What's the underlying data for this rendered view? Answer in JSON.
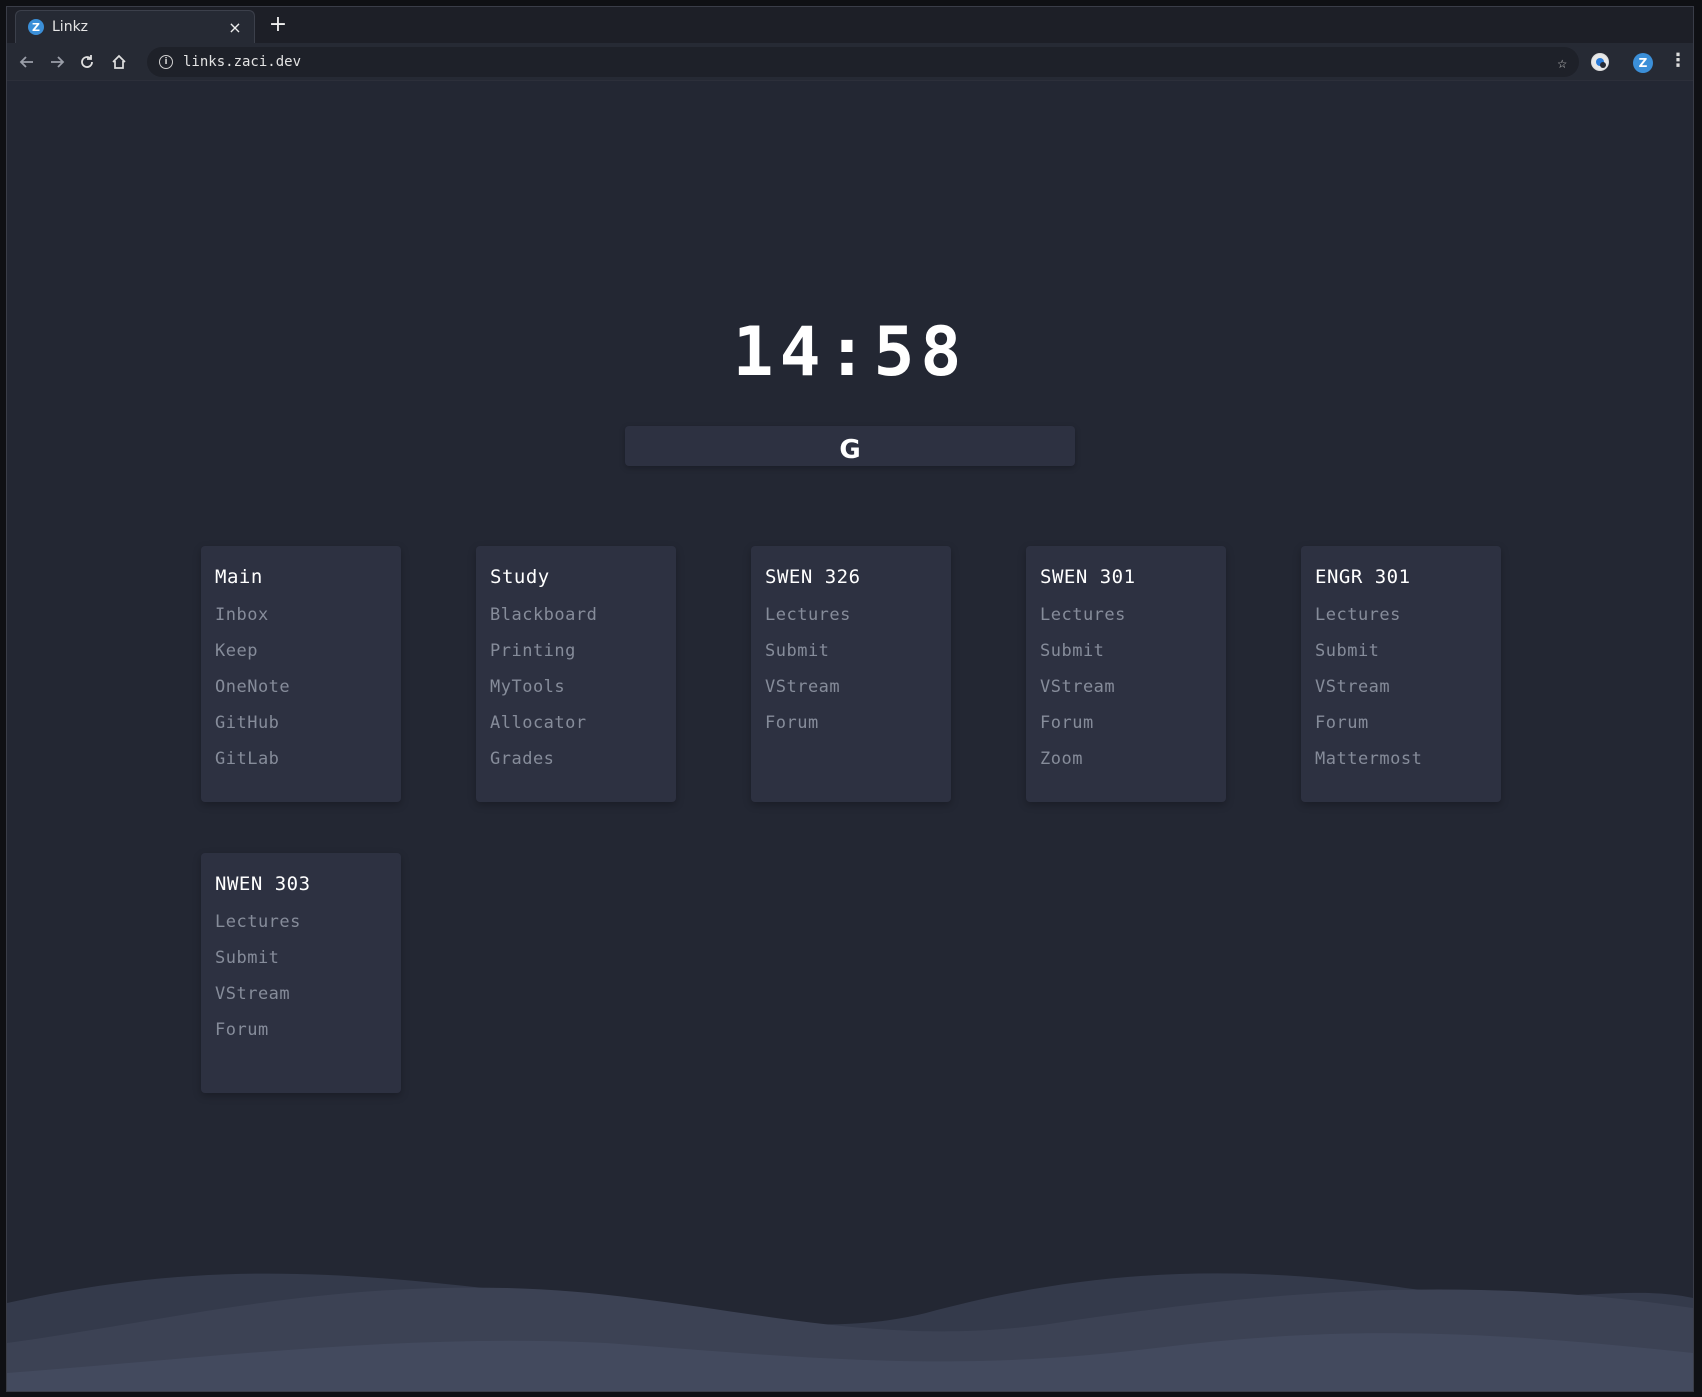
{
  "browser": {
    "tab_title": "Linkz",
    "tab_favicon_letter": "Z",
    "close_glyph": "×",
    "new_tab_glyph": "+",
    "url": "links.zaci.dev",
    "profile_letter": "Z",
    "menu_glyph": "⋮",
    "icons": [
      "back-icon",
      "forward-icon",
      "reload-icon",
      "home-icon",
      "info-icon",
      "star-icon",
      "extension-icon",
      "profile-icon",
      "menu-icon"
    ]
  },
  "page": {
    "clock": "14:58",
    "search_logo": "G",
    "colors": {
      "background": "#232733",
      "card": "#2d3141",
      "card_title": "#ffffff",
      "link": "#868c9a",
      "accent": "#3b8fd8"
    },
    "cards": [
      {
        "title": "Main",
        "links": [
          "Inbox",
          "Keep",
          "OneNote",
          "GitHub",
          "GitLab"
        ]
      },
      {
        "title": "Study",
        "links": [
          "Blackboard",
          "Printing",
          "MyTools",
          "Allocator",
          "Grades"
        ]
      },
      {
        "title": "SWEN 326",
        "links": [
          "Lectures",
          "Submit",
          "VStream",
          "Forum"
        ]
      },
      {
        "title": "SWEN 301",
        "links": [
          "Lectures",
          "Submit",
          "VStream",
          "Forum",
          "Zoom"
        ]
      },
      {
        "title": "ENGR 301",
        "links": [
          "Lectures",
          "Submit",
          "VStream",
          "Forum",
          "Mattermost"
        ]
      },
      {
        "title": "NWEN 303",
        "links": [
          "Lectures",
          "Submit",
          "VStream",
          "Forum"
        ]
      }
    ]
  }
}
